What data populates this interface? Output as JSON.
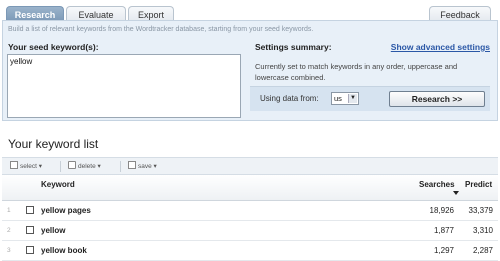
{
  "tabs": [
    {
      "label": "Research"
    },
    {
      "label": "Evaluate"
    },
    {
      "label": "Export"
    }
  ],
  "feedback_label": "Feedback",
  "description": "Build a list of relevant keywords from the Wordtracker database, starting from your seed keywords.",
  "seed": {
    "label": "Your seed keyword(s):",
    "value": "yellow"
  },
  "settings": {
    "title": "Settings summary:",
    "advanced_link": "Show advanced settings",
    "text": "Currently set to match keywords in any order, uppercase and lowercase combined.",
    "using_label": "Using data from:",
    "country": "us",
    "research_button": "Research >>"
  },
  "keyword_list": {
    "title": "Your keyword list",
    "toolbar": {
      "select": "select",
      "delete": "delete",
      "save": "save"
    },
    "columns": {
      "keyword": "Keyword",
      "searches": "Searches",
      "predict": "Predict"
    },
    "rows": [
      {
        "num": "1",
        "keyword": "yellow pages",
        "searches": "18,926",
        "predict": "33,379"
      },
      {
        "num": "2",
        "keyword": "yellow",
        "searches": "1,877",
        "predict": "3,310"
      },
      {
        "num": "3",
        "keyword": "yellow book",
        "searches": "1,297",
        "predict": "2,287"
      }
    ]
  }
}
